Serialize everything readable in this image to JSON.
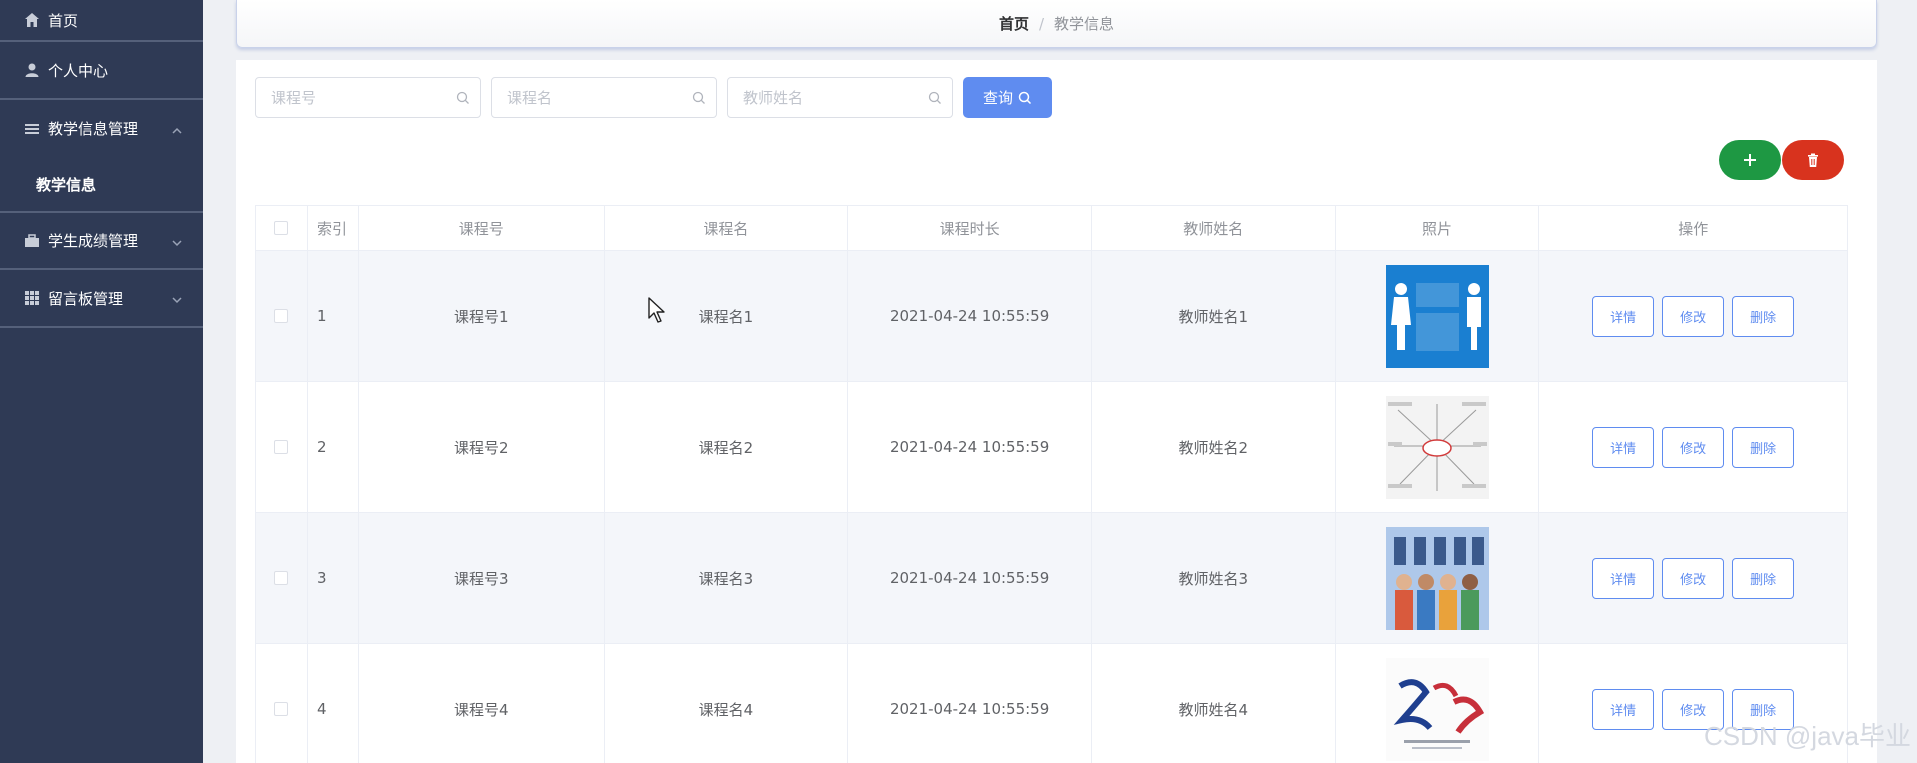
{
  "sidebar": {
    "items": [
      {
        "label": "首页",
        "icon": "home-icon"
      },
      {
        "label": "个人中心",
        "icon": "user-icon"
      },
      {
        "label": "教学信息管理",
        "icon": "menu-icon",
        "expanded": true
      },
      {
        "label": "学生成绩管理",
        "icon": "briefcase-icon"
      },
      {
        "label": "留言板管理",
        "icon": "grid-icon"
      }
    ],
    "sub_item": "教学信息"
  },
  "breadcrumb": {
    "home": "首页",
    "separator": "/",
    "current": "教学信息"
  },
  "search": {
    "course_no_placeholder": "课程号",
    "course_name_placeholder": "课程名",
    "teacher_placeholder": "教师姓名",
    "query_label": "查询"
  },
  "table": {
    "columns": [
      "索引",
      "课程号",
      "课程名",
      "课程时长",
      "教师姓名",
      "照片",
      "操作"
    ],
    "actions": {
      "detail": "详情",
      "edit": "修改",
      "delete": "删除"
    },
    "rows": [
      {
        "index": "1",
        "course_no": "课程号1",
        "course_name": "课程名1",
        "duration": "2021-04-24 10:55:59",
        "teacher": "教师姓名1"
      },
      {
        "index": "2",
        "course_no": "课程号2",
        "course_name": "课程名2",
        "duration": "2021-04-24 10:55:59",
        "teacher": "教师姓名2"
      },
      {
        "index": "3",
        "course_no": "课程号3",
        "course_name": "课程名3",
        "duration": "2021-04-24 10:55:59",
        "teacher": "教师姓名3"
      },
      {
        "index": "4",
        "course_no": "课程号4",
        "course_name": "课程名4",
        "duration": "2021-04-24 10:55:59",
        "teacher": "教师姓名4"
      }
    ]
  },
  "watermark": "CSDN @java毕业",
  "colors": {
    "sidebar_bg": "#2f3a55",
    "primary": "#5f8cf0",
    "add": "#1e9843",
    "delete": "#d8331e"
  }
}
